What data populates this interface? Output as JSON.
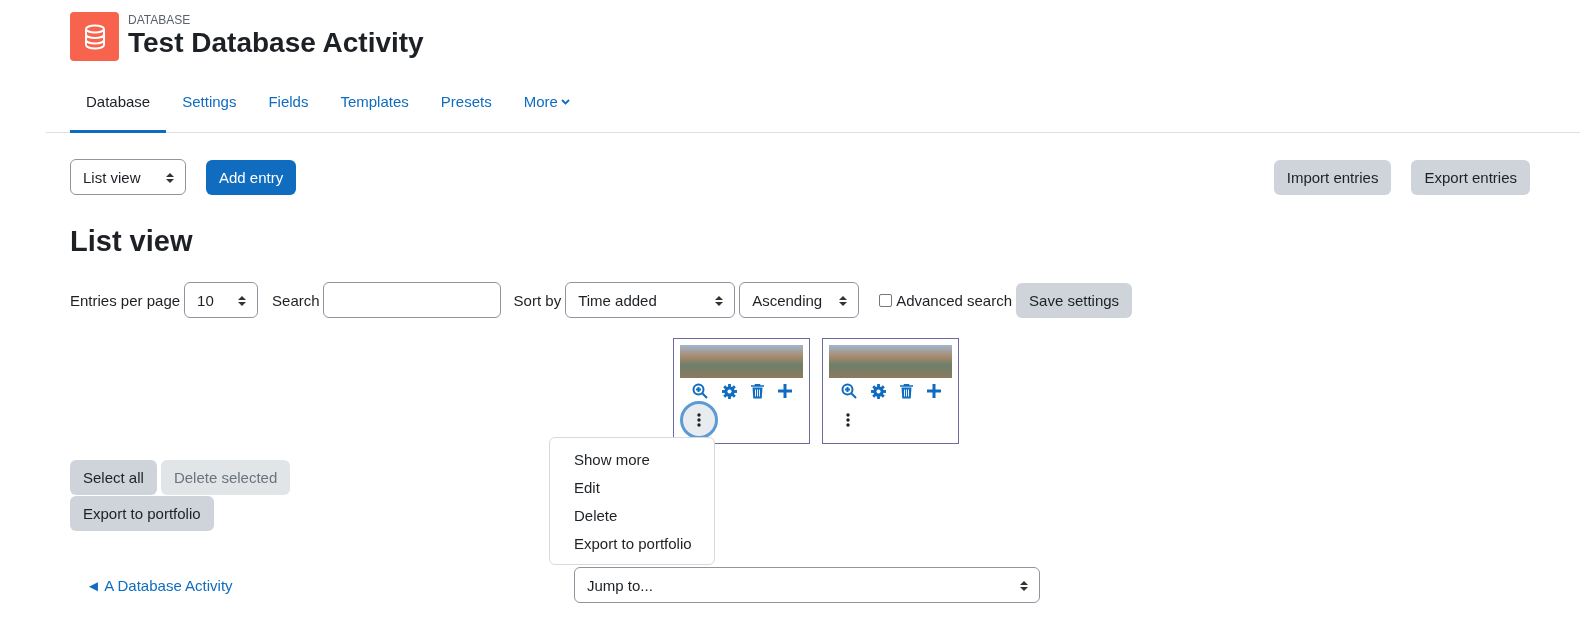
{
  "header": {
    "category": "DATABASE",
    "title": "Test Database Activity"
  },
  "tabs": [
    {
      "label": "Database",
      "selected": true
    },
    {
      "label": "Settings",
      "selected": false
    },
    {
      "label": "Fields",
      "selected": false
    },
    {
      "label": "Templates",
      "selected": false
    },
    {
      "label": "Presets",
      "selected": false
    },
    {
      "label": "More",
      "selected": false
    }
  ],
  "toolbar": {
    "view_select": "List view",
    "add_button": "Add entry",
    "import_button": "Import entries",
    "export_button": "Export entries"
  },
  "heading": "List view",
  "filters": {
    "per_page_label": "Entries per page",
    "per_page_value": "10",
    "search_label": "Search",
    "sort_label": "Sort by",
    "sort_value": "Time added",
    "order_value": "Ascending",
    "advanced_label": "Advanced search",
    "advanced_checked": false,
    "save_button": "Save settings"
  },
  "entries": [
    {
      "menu_open": true
    },
    {
      "menu_open": false
    }
  ],
  "action_menu": {
    "items": [
      "Show more",
      "Edit",
      "Delete",
      "Export to portfolio"
    ]
  },
  "bulk_buttons": [
    {
      "label": "Select all",
      "disabled": false
    },
    {
      "label": "Delete selected",
      "disabled": true
    },
    {
      "label": "Export to portfolio",
      "disabled": false
    }
  ],
  "footer": {
    "back_link": "◄ A Database Activity",
    "jump_select": "Jump to..."
  }
}
